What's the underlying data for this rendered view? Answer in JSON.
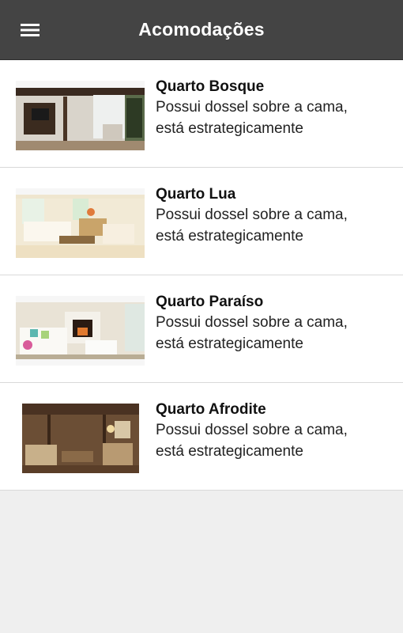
{
  "appbar": {
    "title": "Acomodações",
    "menu_icon": "hamburger-menu-icon",
    "background": "#444444"
  },
  "rooms": [
    {
      "title": "Quarto Bosque",
      "desc_line1": "Possui dossel sobre a cama,",
      "desc_line2": "está estrategicamente"
    },
    {
      "title": "Quarto Lua",
      "desc_line1": "Possui dossel sobre a cama,",
      "desc_line2": "está estrategicamente"
    },
    {
      "title": "Quarto Paraíso",
      "desc_line1": "Possui dossel sobre a cama,",
      "desc_line2": "está estrategicamente"
    },
    {
      "title": "Quarto Afrodite",
      "desc_line1": "Possui dossel sobre a cama,",
      "desc_line2": "está estrategicamente"
    }
  ]
}
